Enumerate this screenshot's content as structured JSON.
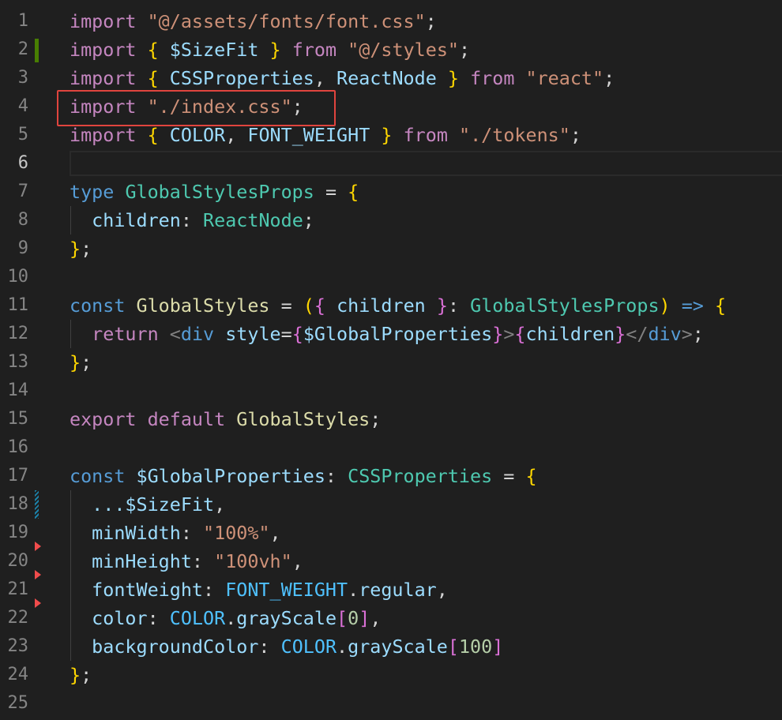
{
  "editor": {
    "line_numbers": [
      "1",
      "2",
      "3",
      "4",
      "5",
      "6",
      "7",
      "8",
      "9",
      "10",
      "11",
      "12",
      "13",
      "14",
      "15",
      "16",
      "17",
      "18",
      "19",
      "20",
      "21",
      "22",
      "23",
      "24",
      "25"
    ],
    "active_line": "6",
    "tokens": {
      "import": "import",
      "from": "from",
      "type": "type",
      "const": "const",
      "return": "return",
      "export": "export",
      "default": "default",
      "font_css": "\"@/assets/fonts/font.css\"",
      "sizefit": "$SizeFit",
      "styles_path": "\"@/styles\"",
      "cssproperties": "CSSProperties",
      "reactnode": "ReactNode",
      "react_path": "\"react\"",
      "index_css": "\"./index.css\"",
      "color": "COLOR",
      "font_weight": "FONT_WEIGHT",
      "tokens_path": "\"./tokens\"",
      "global_styles_props": "GlobalStylesProps",
      "children": "children",
      "global_styles": "GlobalStyles",
      "div": "div",
      "style": "style",
      "global_properties": "$GlobalProperties",
      "spread_sizefit": "...$SizeFit",
      "min_width": "minWidth",
      "min_width_val": "\"100%\"",
      "min_height": "minHeight",
      "min_height_val": "\"100vh\"",
      "font_weight_prop": "fontWeight",
      "regular": "regular",
      "color_prop": "color",
      "gray_scale": "grayScale",
      "zero": "0",
      "background_color": "backgroundColor",
      "hundred": "100"
    }
  }
}
